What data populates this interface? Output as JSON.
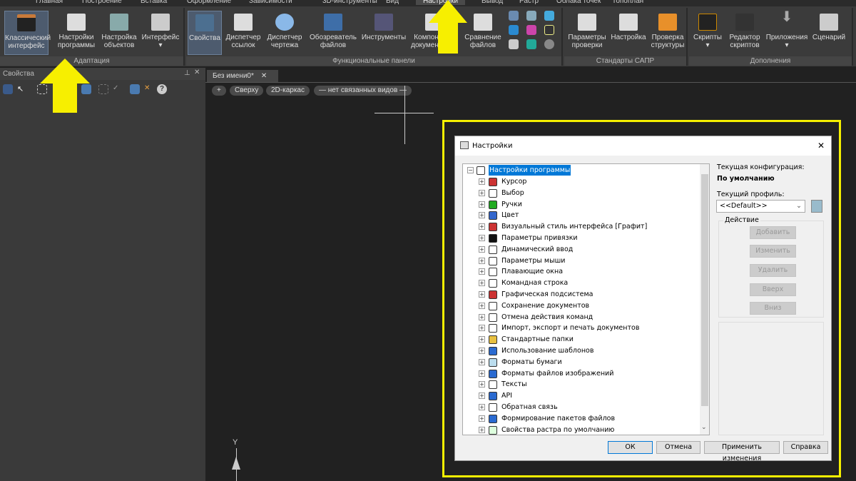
{
  "menu_tabs": [
    "Главная",
    "Построение",
    "Вставка",
    "Оформление",
    "Зависимости",
    "3D-инструменты",
    "Вид",
    "Настройки",
    "Вывод",
    "Растр",
    "Облака точек",
    "Топоплан"
  ],
  "active_tab": "Настройки",
  "ribbon": {
    "adaptation": {
      "label": "Адаптация",
      "buttons": [
        "Классический интерфейс",
        "Настройки программы",
        "Настройка объектов",
        "Интерфейс"
      ]
    },
    "functional": {
      "label": "Функциональные панели",
      "buttons": [
        "Свойства",
        "Диспетчер ссылок",
        "Диспетчер чертежа",
        "Обозреватель файлов",
        "Инструменты",
        "Компоненты документации",
        "Сравнение файлов"
      ]
    },
    "cad": {
      "label": "Стандарты САПР",
      "buttons": [
        "Параметры проверки",
        "Настройка",
        "Проверка структуры"
      ]
    },
    "addons": {
      "label": "Дополнения",
      "buttons": [
        "Скрипты",
        "Редактор скриптов",
        "Приложения",
        "Сценарий"
      ]
    }
  },
  "properties_panel": {
    "title": "Свойства"
  },
  "document_tab": "Без имени0*",
  "view_pills": [
    "+",
    "Сверху",
    "2D-каркас",
    "— нет связанных видов —"
  ],
  "ucs_label": "Y",
  "dialog": {
    "title": "Настройки",
    "root": "Настройки программы",
    "tree": [
      "Курсор",
      "Выбор",
      "Ручки",
      "Цвет",
      "Визуальный стиль интерфейса [Графит]",
      "Параметры привязки",
      "Динамический ввод",
      "Параметры мыши",
      "Плавающие окна",
      "Командная строка",
      "Графическая подсистема",
      "Сохранение документов",
      "Отмена действия команд",
      "Импорт, экспорт и печать документов",
      "Стандартные папки",
      "Использование шаблонов",
      "Форматы бумаги",
      "Форматы файлов изображений",
      "Тексты",
      "API",
      "Обратная связь",
      "Формирование пакетов файлов",
      "Свойства растра по умолчанию"
    ],
    "current_config_label": "Текущая конфигурация:",
    "current_config": "По умолчанию",
    "profile_label": "Текущий профиль:",
    "profile_value": "<<Default>>",
    "action_group": "Действие",
    "actions": [
      "Добавить",
      "Изменить",
      "Удалить",
      "Вверх",
      "Вниз"
    ],
    "buttons": {
      "ok": "ОК",
      "cancel": "Отмена",
      "apply": "Применить изменения",
      "help": "Справка"
    }
  },
  "colors": {
    "highlight": "#f5f000",
    "selection": "#0078d7"
  }
}
